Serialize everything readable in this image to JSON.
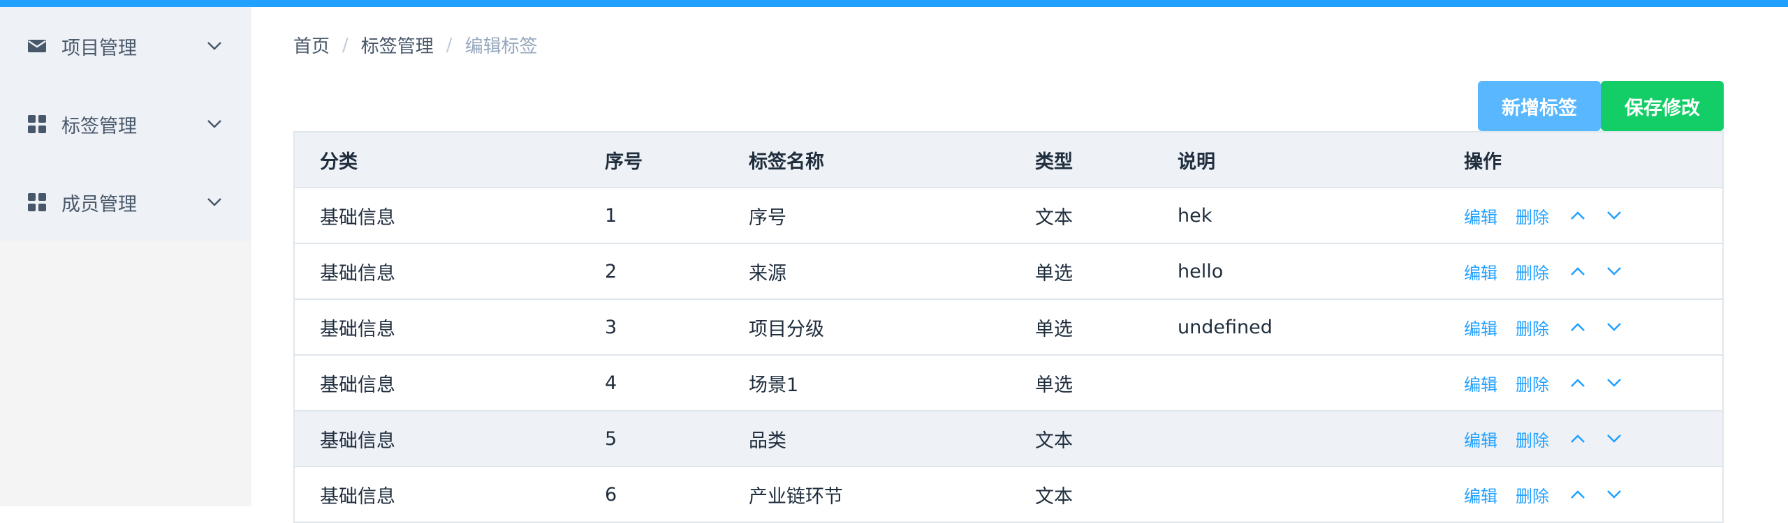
{
  "colors": {
    "accent": "#20a0ff",
    "add_button": "#58b7ff",
    "save_button": "#13ce66",
    "menu_bg": "#eef1f6"
  },
  "sidebar": {
    "items": [
      {
        "label": "项目管理",
        "icon": "envelope-icon",
        "chevron": "chevron-down-icon"
      },
      {
        "label": "标签管理",
        "icon": "grid-icon",
        "chevron": "chevron-down-icon"
      },
      {
        "label": "成员管理",
        "icon": "grid-icon",
        "chevron": "chevron-down-icon"
      }
    ]
  },
  "breadcrumb": {
    "items": [
      "首页",
      "标签管理",
      "编辑标签"
    ],
    "separator": "/"
  },
  "toolbar": {
    "add_label": "新增标签",
    "save_label": "保存修改"
  },
  "table": {
    "headers": [
      "分类",
      "序号",
      "标签名称",
      "类型",
      "说明",
      "操作"
    ],
    "actions": {
      "edit": "编辑",
      "delete": "删除",
      "up_icon": "chevron-up-icon",
      "down_icon": "chevron-down-icon"
    },
    "rows": [
      {
        "category": "基础信息",
        "index": "1",
        "name": "序号",
        "type": "文本",
        "desc": "hek"
      },
      {
        "category": "基础信息",
        "index": "2",
        "name": "来源",
        "type": "单选",
        "desc": "hello"
      },
      {
        "category": "基础信息",
        "index": "3",
        "name": "项目分级",
        "type": "单选",
        "desc": "undefined"
      },
      {
        "category": "基础信息",
        "index": "4",
        "name": "场景1",
        "type": "单选",
        "desc": ""
      },
      {
        "category": "基础信息",
        "index": "5",
        "name": "品类",
        "type": "文本",
        "desc": ""
      },
      {
        "category": "基础信息",
        "index": "6",
        "name": "产业链环节",
        "type": "文本",
        "desc": ""
      }
    ]
  }
}
